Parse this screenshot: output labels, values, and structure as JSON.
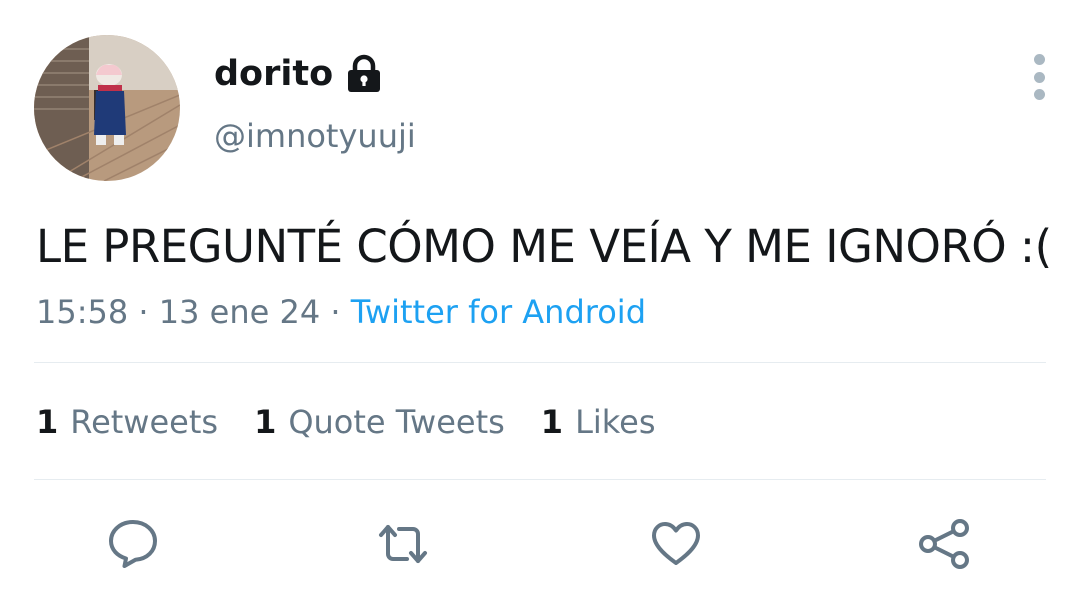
{
  "author": {
    "display_name": "dorito",
    "handle": "@imnotyuuji",
    "protected_icon": "lock-icon"
  },
  "tweet": {
    "text": "LE PREGUNTÉ CÓMO ME VEÍA Y ME IGNORÓ :(",
    "time": "15:58",
    "separator": "·",
    "date": "13 ene 24",
    "source": "Twitter for Android"
  },
  "stats": [
    {
      "count": "1",
      "label": "Retweets"
    },
    {
      "count": "1",
      "label": "Quote Tweets"
    },
    {
      "count": "1",
      "label": "Likes"
    }
  ],
  "actions": {
    "reply_icon": "reply-icon",
    "retweet_icon": "retweet-icon",
    "like_icon": "heart-icon",
    "share_icon": "share-icon"
  },
  "colors": {
    "text": "#14171a",
    "muted": "#657786",
    "link": "#1da1f2",
    "icon": "#657786",
    "divider": "#e6ecf0"
  }
}
